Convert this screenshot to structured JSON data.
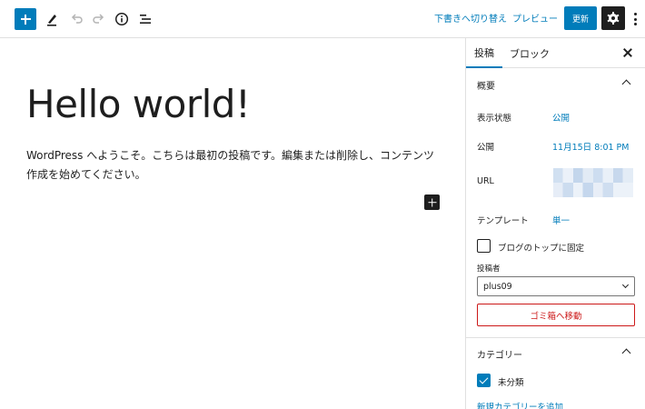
{
  "toolbar": {
    "icons": [
      "plus-icon",
      "pen-icon",
      "undo-icon",
      "redo-icon",
      "info-icon",
      "list-view-icon",
      "gear-icon",
      "more-vertical-icon"
    ],
    "switch_to_draft_label": "下書きへ切り替え",
    "preview_label": "プレビュー",
    "update_label": "更新"
  },
  "editor": {
    "title": "Hello world!",
    "body": "WordPress へようこそ。こちらは最初の投稿です。編集または削除し、コンテンツ作成を始めてください。"
  },
  "sidebar": {
    "tabs": [
      "投稿",
      "ブロック"
    ],
    "summary_panel": {
      "title": "概要",
      "rows": {
        "visibility": {
          "label": "表示状態",
          "value": "公開"
        },
        "publish": {
          "label": "公開",
          "value": "11月15日 8:01 PM"
        },
        "url": {
          "label": "URL"
        },
        "template": {
          "label": "テンプレート",
          "value": "単一"
        }
      },
      "sticky_label": "ブログのトップに固定",
      "sticky_checked": false,
      "author_label": "投稿者",
      "author_value": "plus09",
      "trash_label": "ゴミ箱へ移動"
    },
    "category_panel": {
      "title": "カテゴリー",
      "items": [
        {
          "label": "未分類",
          "checked": true
        }
      ],
      "add_new_label": "新規カテゴリーを追加"
    }
  },
  "colors": {
    "accent": "#007cba",
    "destructive": "#cc1818",
    "dark": "#1e1e1e",
    "border": "#e0e0e0"
  }
}
